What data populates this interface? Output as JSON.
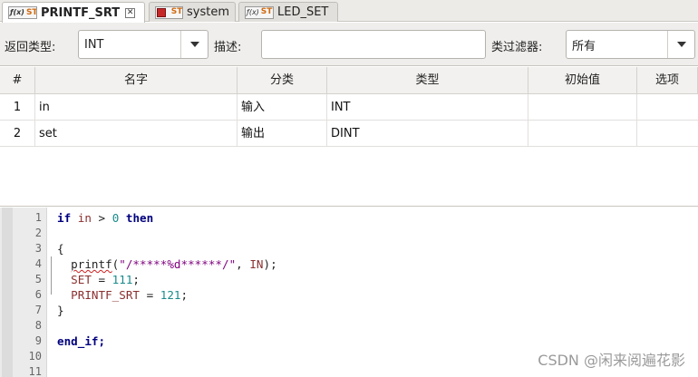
{
  "tabs": [
    {
      "label": "PRINTF_SRT",
      "icon": "function-block-st-icon",
      "active": true
    },
    {
      "label": "system",
      "icon": "program-st-icon",
      "active": false
    },
    {
      "label": "LED_SET",
      "icon": "function-block-st-icon",
      "active": false
    }
  ],
  "filter": {
    "return_type_label": "返回类型:",
    "return_type_value": "INT",
    "description_label": "描述:",
    "description_value": "",
    "class_filter_label": "类过滤器:",
    "class_filter_value": "所有"
  },
  "table": {
    "headers": [
      "#",
      "名字",
      "分类",
      "类型",
      "初始值",
      "选项"
    ],
    "rows": [
      {
        "num": "1",
        "name": "in",
        "class": "输入",
        "type": "INT",
        "init": "",
        "option": ""
      },
      {
        "num": "2",
        "name": "set",
        "class": "输出",
        "type": "DINT",
        "init": "",
        "option": ""
      }
    ]
  },
  "editor": {
    "line_numbers": [
      "1",
      "2",
      "3",
      "4",
      "5",
      "6",
      "7",
      "8",
      "9",
      "10",
      "11"
    ],
    "line1": {
      "kw_if": "if",
      "var_in": "in",
      "op": " > ",
      "num": "0",
      "kw_then": "then"
    },
    "line3": "{",
    "line4": {
      "fn": "printf",
      "open": "(",
      "str": "\"/*****%d******/\"",
      "sep": ", ",
      "var": "IN",
      "close": ");"
    },
    "line5": {
      "var": "SET",
      "op": " = ",
      "num": "111",
      "end": ";"
    },
    "line6": {
      "var": "PRINTF_SRT",
      "op": " = ",
      "num": "121",
      "end": ";"
    },
    "line7": "}",
    "line9": {
      "kw": "end_if",
      "end": ";"
    }
  },
  "watermark": "CSDN @闲来阅遍花影"
}
